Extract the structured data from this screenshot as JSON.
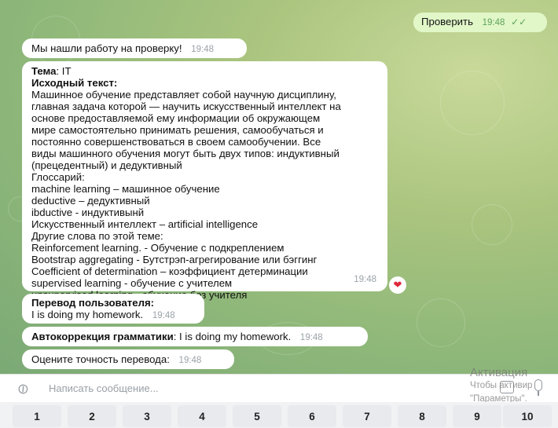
{
  "outgoing": {
    "text": "Проверить",
    "time": "19:48"
  },
  "messages": {
    "found": {
      "text": "Мы нашли работу на проверку!",
      "time": "19:48"
    },
    "task": {
      "topic_label": "Тема",
      "topic_value": ": IT",
      "source_label": "Исходный текст",
      "source_colon": ":",
      "lines": [
        "Машинное обучение представляет собой научную дисциплину,",
        "главная задача которой — научить искусственный интеллект на",
        "основе предоставляемой ему информации об окружающем",
        "мире самостоятельно принимать решения, самообучаться и",
        "постоянно совершенствоваться в своем самообучении. Все",
        "виды машинного обучения могут быть двух типов: индуктивный",
        "(прецедентный) и дедуктивный",
        "Глоссарий:",
        "machine learning – машинное обучение",
        "deductive – дедуктивный",
        "ibductive - индуктивынй",
        "Искусственный интеллект – artificial intelligence",
        "Другие слова по этой теме:",
        "Reinforcement learning. - Обучение с подкреплением",
        "Bootstrap aggregating - Бутстрэп-агрегирование или бэггинг",
        "Coefficient of determination – коэффициент детерминации",
        "supervised learning - обучение с учителем",
        "unsupervised learning - обучение без учителя"
      ],
      "time": "19:48"
    },
    "user_translation": {
      "label": "Перевод пользователя:",
      "text": "I is doing my homework.",
      "time": "19:48"
    },
    "autocorrection": {
      "label": "Автокоррекция грамматики",
      "text": ": I is doing my homework.",
      "time": "19:48"
    },
    "rate": {
      "text": "Оцените точность перевода:",
      "time": "19:48"
    }
  },
  "input": {
    "placeholder": "Написать сообщение..."
  },
  "keyboard": {
    "keys": [
      "1",
      "2",
      "3",
      "4",
      "5",
      "6",
      "7",
      "8",
      "9",
      "10"
    ]
  },
  "watermark": {
    "line1": "Активация",
    "line2": "Чтобы активир",
    "line3": "\"Параметры\"."
  },
  "icons": {
    "attach": "paperclip-icon",
    "commands": "keyboard-icon",
    "voice": "microphone-icon",
    "reaction": "heart-icon",
    "read": "double-check-icon"
  }
}
